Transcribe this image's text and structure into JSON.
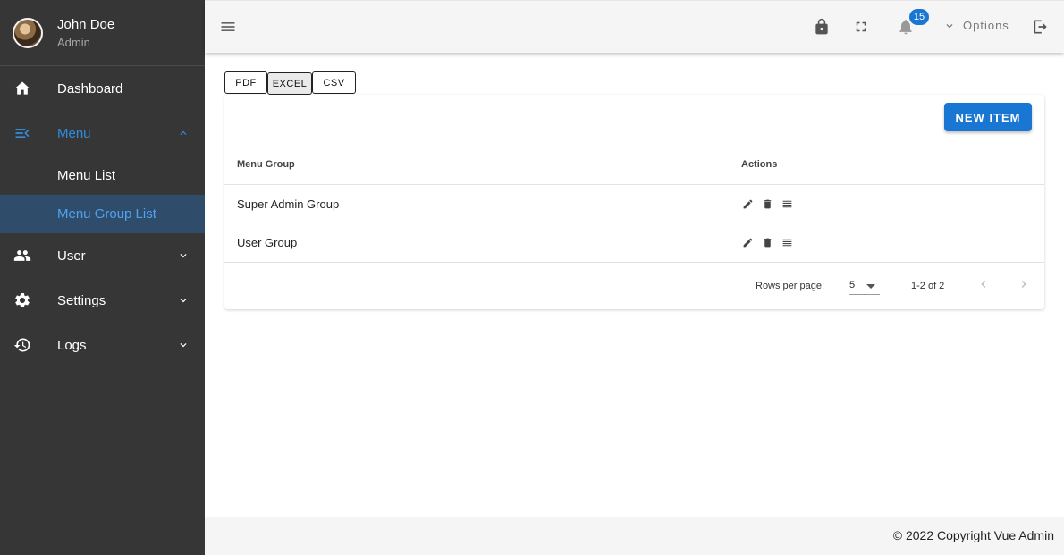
{
  "user": {
    "name": "John Doe",
    "role": "Admin"
  },
  "sidebar": {
    "items": [
      {
        "label": "Dashboard",
        "icon": "home-icon"
      },
      {
        "label": "Menu",
        "icon": "menu-open-icon",
        "expanded": true
      },
      {
        "label": "User",
        "icon": "people-icon"
      },
      {
        "label": "Settings",
        "icon": "gear-icon"
      },
      {
        "label": "Logs",
        "icon": "history-icon"
      }
    ],
    "submenu": [
      {
        "label": "Menu List"
      },
      {
        "label": "Menu Group List",
        "selected": true
      }
    ]
  },
  "topbar": {
    "notification_count": "15",
    "options_label": "Options"
  },
  "export": {
    "pdf": "PDF",
    "excel": "EXCEL",
    "csv": "CSV"
  },
  "table": {
    "new_button": "NEW ITEM",
    "headers": {
      "group": "Menu Group",
      "actions": "Actions"
    },
    "rows": [
      {
        "group": "Super Admin Group"
      },
      {
        "group": "User Group"
      }
    ],
    "rows_per_page_label": "Rows per page:",
    "rows_per_page": "5",
    "range": "1-2 of 2"
  },
  "footer": {
    "copyright": "© 2022 Copyright Vue Admin"
  },
  "colors": {
    "accent": "#1976d2",
    "sidebar_bg": "#363636",
    "selected_bg": "#2f4d6b",
    "active_text": "#2f8ce0"
  }
}
